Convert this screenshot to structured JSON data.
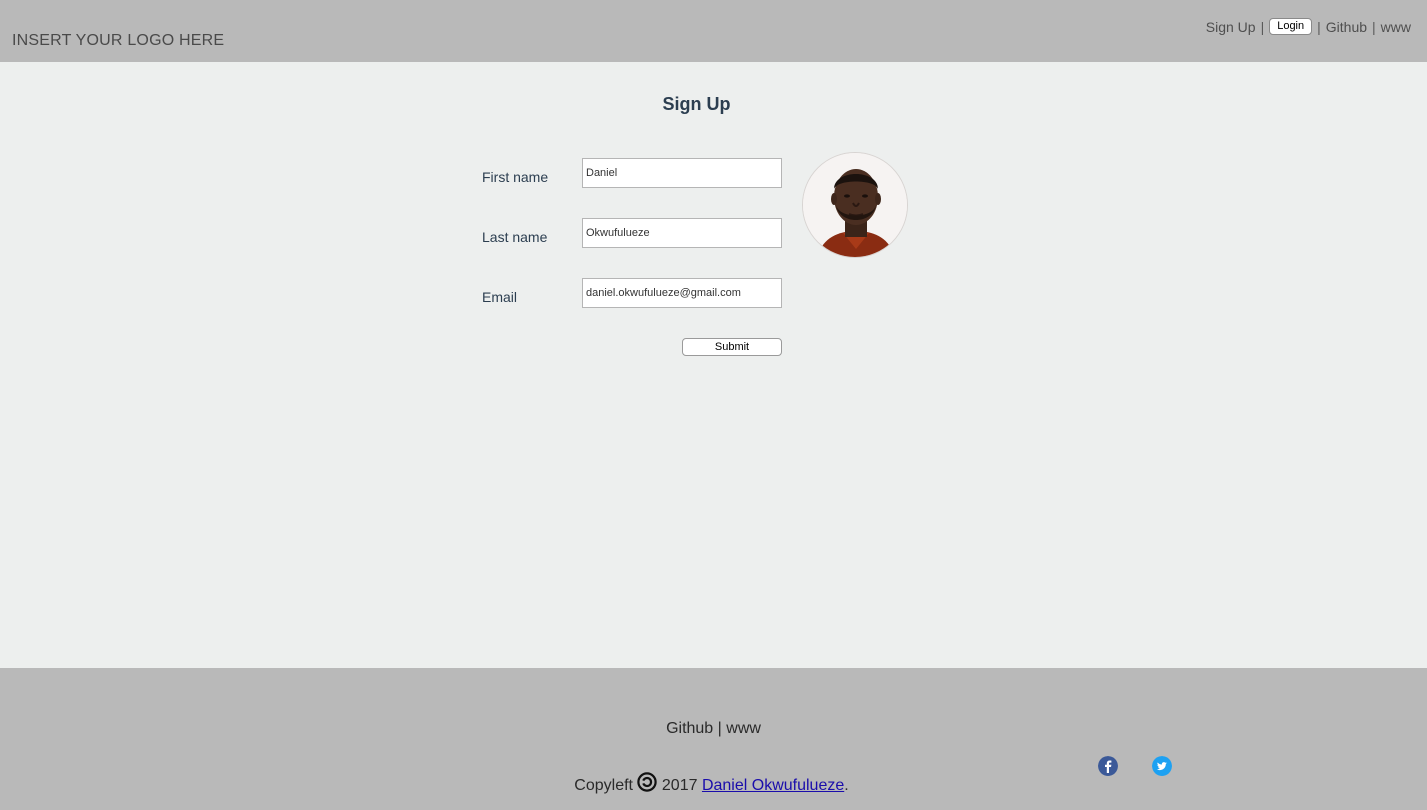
{
  "header": {
    "logo_text": "INSERT YOUR LOGO HERE",
    "nav": {
      "signup_label": "Sign Up",
      "login_label": "Login",
      "github_label": "Github",
      "www_label": "www",
      "separator": "|"
    }
  },
  "form": {
    "title": "Sign Up",
    "first_name": {
      "label": "First name",
      "value": "Daniel"
    },
    "last_name": {
      "label": "Last name",
      "value": "Okwufulueze"
    },
    "email": {
      "label": "Email",
      "value": "daniel.okwufulueze@gmail.com"
    },
    "submit_label": "Submit"
  },
  "footer": {
    "github_label": "Github",
    "separator": "|",
    "www_label": "www",
    "copyleft_prefix": "Copyleft",
    "year": "2017",
    "author": "Daniel Okwufulueze",
    "period": ".",
    "icons": [
      "facebook-icon",
      "twitter-icon"
    ]
  },
  "colors": {
    "header_bg": "#b9b9b9",
    "page_bg": "#edefee",
    "heading": "#2c3e50",
    "facebook": "#3b5998",
    "twitter": "#1da1f2",
    "link": "#1a0dab"
  }
}
